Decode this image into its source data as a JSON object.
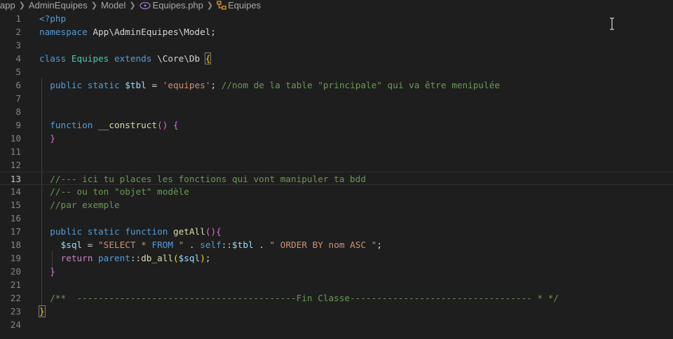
{
  "breadcrumb": {
    "items": [
      "app",
      "AdminEquipes",
      "Model",
      "Equipes.php",
      "Equipes"
    ],
    "separator": ">"
  },
  "editor": {
    "current_line": 13,
    "lines": [
      {
        "n": "1",
        "tokens": [
          [
            "<?php",
            "k-php"
          ]
        ]
      },
      {
        "n": "2",
        "tokens": [
          [
            "namespace",
            "k-blue"
          ],
          [
            " App\\AdminEquipes\\Model;",
            "t-ns"
          ]
        ]
      },
      {
        "n": "3",
        "tokens": []
      },
      {
        "n": "4",
        "tokens": [
          [
            "class",
            "k-blue"
          ],
          [
            " ",
            ""
          ],
          [
            "Equipes",
            "t-type"
          ],
          [
            " ",
            ""
          ],
          [
            "extends",
            "k-blue"
          ],
          [
            " \\Core\\Db ",
            "t-ns"
          ],
          [
            "{",
            "t-brace t-match"
          ]
        ]
      },
      {
        "n": "5",
        "tokens": []
      },
      {
        "n": "6",
        "tokens": [
          [
            "  ",
            ""
          ],
          [
            "public",
            "k-blue"
          ],
          [
            " ",
            ""
          ],
          [
            "static",
            "k-blue"
          ],
          [
            " ",
            ""
          ],
          [
            "$tbl",
            "t-var"
          ],
          [
            " = ",
            ""
          ],
          [
            "'equipes'",
            "t-str"
          ],
          [
            "; ",
            ""
          ],
          [
            "//nom de la table \"principale\" qui va être menipulée",
            "t-com"
          ]
        ]
      },
      {
        "n": "7",
        "tokens": []
      },
      {
        "n": "8",
        "tokens": []
      },
      {
        "n": "9",
        "tokens": [
          [
            "  ",
            ""
          ],
          [
            "function",
            "k-blue"
          ],
          [
            " ",
            ""
          ],
          [
            "__construct",
            "t-fn"
          ],
          [
            "()",
            "t-paren"
          ],
          [
            " ",
            ""
          ],
          [
            "{",
            "t-paren"
          ]
        ]
      },
      {
        "n": "10",
        "tokens": [
          [
            "  ",
            ""
          ],
          [
            "}",
            "t-paren"
          ]
        ]
      },
      {
        "n": "11",
        "tokens": []
      },
      {
        "n": "12",
        "tokens": []
      },
      {
        "n": "13",
        "tokens": [
          [
            "  ",
            ""
          ],
          [
            "//--- ici tu places les fonctions qui vont manipuler ta bdd",
            "t-com"
          ]
        ]
      },
      {
        "n": "14",
        "tokens": [
          [
            "  ",
            ""
          ],
          [
            "//-- ou ton \"objet\" modèle",
            "t-com"
          ]
        ]
      },
      {
        "n": "15",
        "tokens": [
          [
            "  ",
            ""
          ],
          [
            "//par exemple",
            "t-com"
          ]
        ]
      },
      {
        "n": "16",
        "tokens": []
      },
      {
        "n": "17",
        "tokens": [
          [
            "  ",
            ""
          ],
          [
            "public",
            "k-blue"
          ],
          [
            " ",
            ""
          ],
          [
            "static",
            "k-blue"
          ],
          [
            " ",
            ""
          ],
          [
            "function",
            "k-blue"
          ],
          [
            " ",
            ""
          ],
          [
            "getAll",
            "t-fn"
          ],
          [
            "()",
            "t-paren"
          ],
          [
            "{",
            "t-paren"
          ]
        ]
      },
      {
        "n": "18",
        "tokens": [
          [
            "    ",
            ""
          ],
          [
            "$sql",
            "t-var"
          ],
          [
            " = ",
            ""
          ],
          [
            "\"SELECT * ",
            "t-str"
          ],
          [
            "FROM",
            "k-blue"
          ],
          [
            " \"",
            "t-str"
          ],
          [
            " . ",
            ""
          ],
          [
            "self",
            "k-blue"
          ],
          [
            "::",
            ""
          ],
          [
            "$tbl",
            "t-var"
          ],
          [
            " . ",
            ""
          ],
          [
            "\" ORDER BY nom ASC \"",
            "t-str"
          ],
          [
            ";",
            ""
          ]
        ]
      },
      {
        "n": "19",
        "tokens": [
          [
            "    ",
            ""
          ],
          [
            "return",
            "k-ctrl"
          ],
          [
            " ",
            ""
          ],
          [
            "parent",
            "k-blue"
          ],
          [
            "::",
            ""
          ],
          [
            "db_all",
            "t-fn"
          ],
          [
            "(",
            "t-brace"
          ],
          [
            "$sql",
            "t-var"
          ],
          [
            ")",
            "t-brace"
          ],
          [
            ";",
            ""
          ]
        ]
      },
      {
        "n": "20",
        "tokens": [
          [
            "  ",
            ""
          ],
          [
            "}",
            "t-paren"
          ]
        ]
      },
      {
        "n": "21",
        "tokens": []
      },
      {
        "n": "22",
        "tokens": [
          [
            "  ",
            ""
          ],
          [
            "/**  -----------------------------------------Fin Classe---------------------------------- * */",
            "t-com"
          ]
        ]
      },
      {
        "n": "23",
        "tokens": [
          [
            "}",
            "t-brace t-match"
          ]
        ]
      },
      {
        "n": "24",
        "tokens": []
      }
    ]
  }
}
